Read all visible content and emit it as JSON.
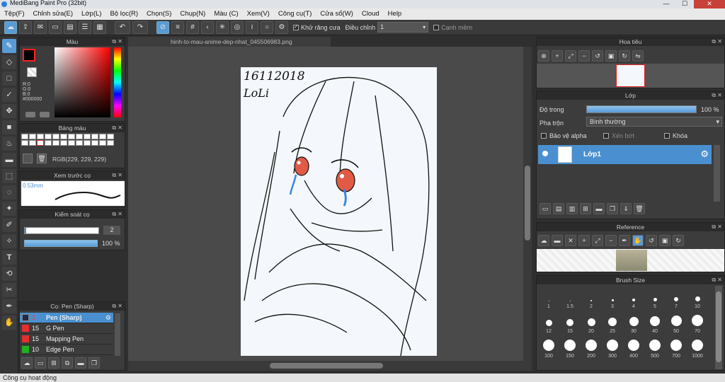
{
  "window": {
    "title": "MediBang Paint Pro (32bit)"
  },
  "menu": [
    "Tệp(F)",
    "Chỉnh sửa(E)",
    "Lớp(L)",
    "Bộ lọc(R)",
    "Chọn(S)",
    "Chụp(N)",
    "Màu (C)",
    "Xem(V)",
    "Công cụ(T)",
    "Cửa sổ(W)",
    "Cloud",
    "Help"
  ],
  "toolbar": {
    "antialias_label": "Khử răng cưa",
    "adjust_label": "Điều chỉnh",
    "adjust_value": "1",
    "snap_label": "Cạnh mềm"
  },
  "document": {
    "tab_name": "hinh-to-mau-anime-dep-nhat_045506983.png"
  },
  "color_panel": {
    "title": "Màu",
    "rgb_lines": [
      "R:0",
      "G:0",
      "B:0",
      "#000000"
    ],
    "foreground": "#000000"
  },
  "palette_panel": {
    "title": "Bảng màu",
    "rgb_readout": "RGB(229, 229, 229)"
  },
  "brush_preview_panel": {
    "title": "Xem trước cọ",
    "size_label": "0.53mm"
  },
  "brush_control_panel": {
    "title": "Kiểm soát cọ",
    "size_value": "2",
    "opacity_value": "100 %"
  },
  "brush_list_panel": {
    "title": "Cọ: Pen (Sharp)",
    "items": [
      {
        "size": "2",
        "name": "Pen (Sharp)",
        "color": "#1f2a44",
        "selected": true
      },
      {
        "size": "15",
        "name": "G Pen",
        "color": "#e03030",
        "selected": false
      },
      {
        "size": "15",
        "name": "Mapping Pen",
        "color": "#e03030",
        "selected": false
      },
      {
        "size": "10",
        "name": "Edge Pen",
        "color": "#20b020",
        "selected": false
      }
    ]
  },
  "navigator_panel": {
    "title": "Hoa tiêu"
  },
  "layer_panel": {
    "title": "Lớp",
    "opacity_label": "Độ trong",
    "opacity_value": "100 %",
    "opacity_fraction": 1.0,
    "blend_label": "Pha trộn",
    "blend_value": "Bình thường",
    "protect_alpha": "Bảo vệ alpha",
    "clipping": "Xén bớt",
    "lock": "Khóa",
    "layer_name": "Lớp1"
  },
  "reference_panel": {
    "title": "Reference"
  },
  "brush_size_panel": {
    "title": "Brush Size",
    "sizes": [
      "1",
      "1.5",
      "2",
      "3",
      "4",
      "5",
      "7",
      "10",
      "12",
      "15",
      "20",
      "25",
      "30",
      "40",
      "50",
      "70",
      "100",
      "150",
      "200",
      "300",
      "400",
      "500",
      "700",
      "1000"
    ]
  },
  "status": {
    "text": "Công cụ hoạt động"
  },
  "artwork": {
    "handwriting": [
      "16112018",
      "LoLi"
    ]
  }
}
